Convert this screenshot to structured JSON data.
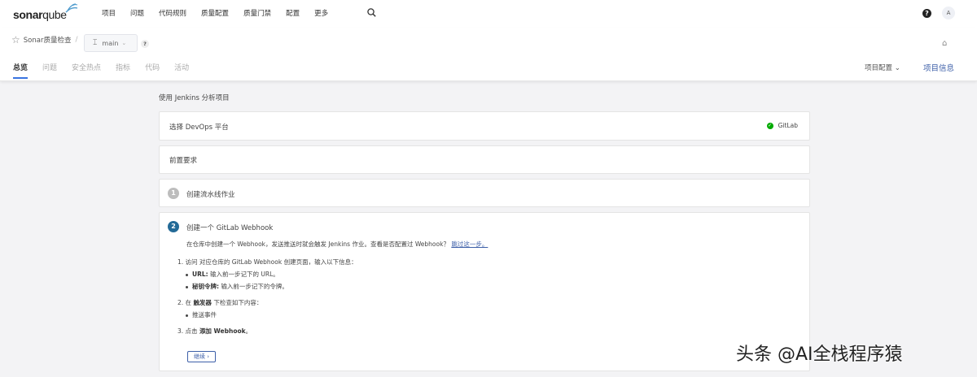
{
  "brand": {
    "name_bold": "sonar",
    "name_light": "qube"
  },
  "nav": {
    "items": [
      {
        "label": "项目"
      },
      {
        "label": "问题"
      },
      {
        "label": "代码规则"
      },
      {
        "label": "质量配置"
      },
      {
        "label": "质量门禁"
      },
      {
        "label": "配置"
      },
      {
        "label": "更多"
      }
    ],
    "help_label": "?",
    "avatar_letter": "A"
  },
  "project": {
    "name": "Sonar质量检查",
    "separator": "/",
    "branch": "main",
    "help_label": "?"
  },
  "tabs": [
    {
      "label": "总览"
    },
    {
      "label": "问题"
    },
    {
      "label": "安全热点"
    },
    {
      "label": "指标"
    },
    {
      "label": "代码"
    },
    {
      "label": "活动"
    }
  ],
  "right_tabs": {
    "config_label": "项目配置",
    "info_label": "项目信息"
  },
  "main": {
    "title": "使用 Jenkins 分析项目",
    "devops_card": {
      "label": "选择 DevOps 平台",
      "selected": "GitLab"
    },
    "prereq_card": {
      "label": "前置要求"
    },
    "step1": {
      "num": "1",
      "label": "创建流水线作业"
    },
    "step2": {
      "num": "2",
      "label": "创建一个 GitLab Webhook",
      "intro": "在仓库中创建一个 Webhook，发送推送时就会触发 Jenkins 作业。查看是否配置过 Webhook？",
      "skip_link": "跳过这一步。",
      "item1": "1. 访问 对应仓库的 GitLab Webhook 创建页面，输入以下信息：",
      "item1_sub1_key": "URL:",
      "item1_sub1_val": " 输入前一步记下的 URL。",
      "item1_sub2_key": "秘钥令牌:",
      "item1_sub2_val": " 输入前一步记下的令牌。",
      "item2_pre": "2. 在 ",
      "item2_bold": "触发器",
      "item2_post": " 下检查如下内容：",
      "item2_sub1": "推送事件",
      "item3_pre": "3. 点击 ",
      "item3_bold": "添加 Webhook",
      "item3_post": "。",
      "continue_label": "继续 ›"
    }
  },
  "watermark": "头条 @AI全栈程序猿",
  "colors": {
    "accent": "#3974e1",
    "link": "#3d5fa8",
    "step_active": "#236a97",
    "success": "#00aa00"
  }
}
